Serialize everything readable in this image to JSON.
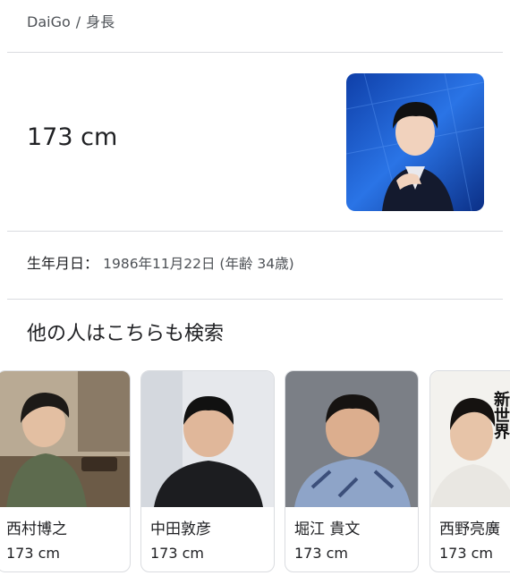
{
  "breadcrumb": {
    "entity": "DaiGo",
    "separator": "/",
    "attribute": "身長"
  },
  "answer": {
    "height": "173 cm"
  },
  "profile_photo": {
    "icon": "person-photo",
    "bg_color": "#1f5fd1"
  },
  "birth": {
    "label": "生年月日：",
    "value": "1986年11月22日 (年齢 34歳)"
  },
  "related": {
    "title": "他の人はこちらも検索",
    "people": [
      {
        "name": "西村博之",
        "height": "173 cm"
      },
      {
        "name": "中田敦彦",
        "height": "173 cm"
      },
      {
        "name": "堀江 貴文",
        "height": "173 cm"
      },
      {
        "name": "西野亮廣",
        "height": "173 cm",
        "overlay_text": "新世界"
      }
    ]
  }
}
